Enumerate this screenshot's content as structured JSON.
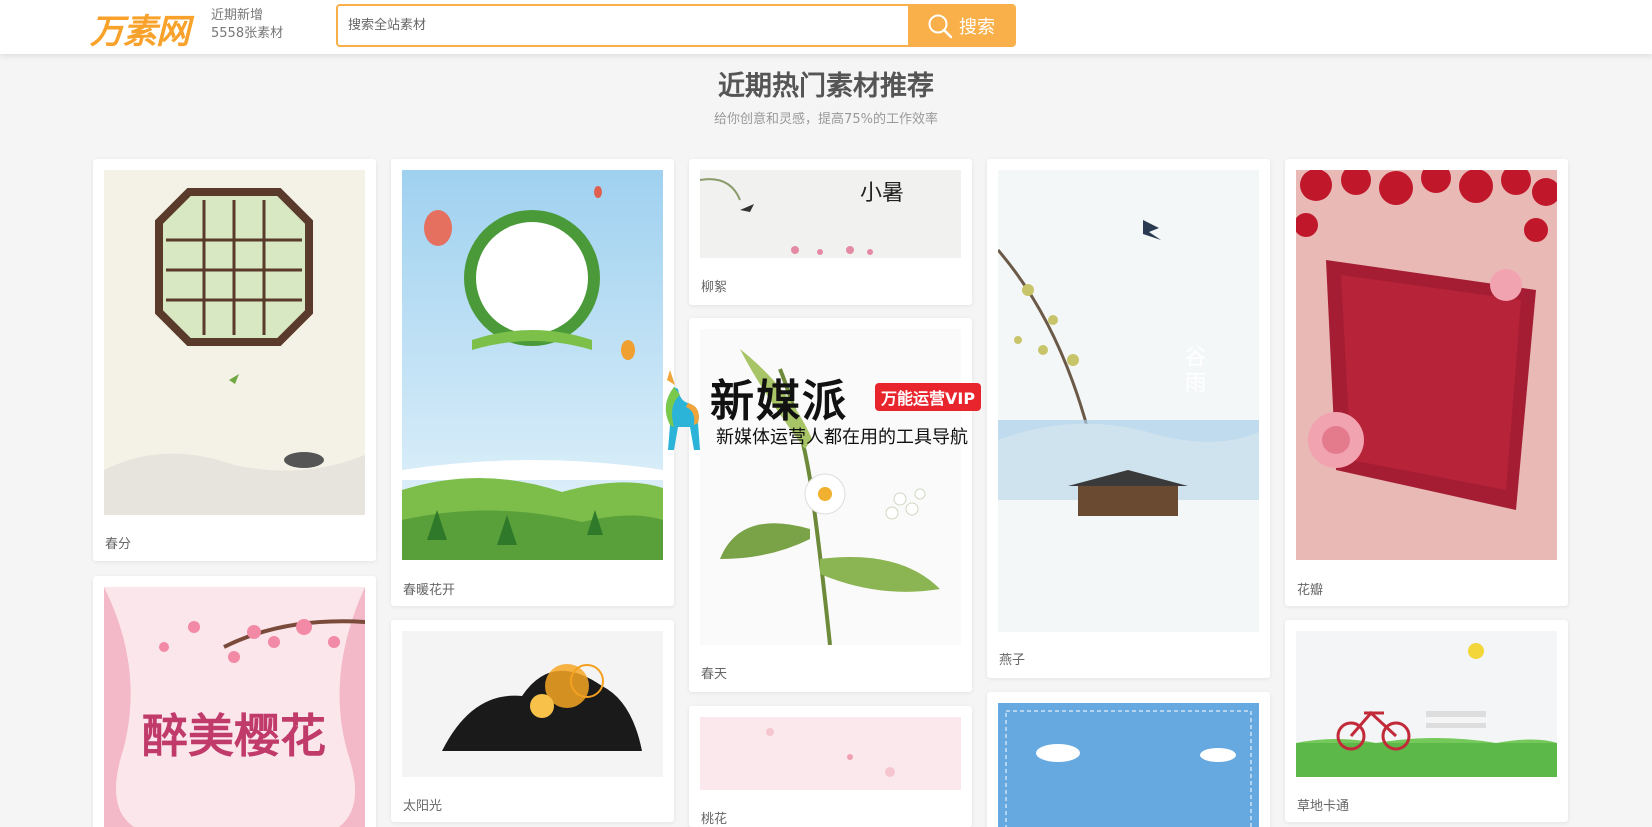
{
  "header": {
    "logo": "万素网",
    "logo_sub_line1": "近期新增",
    "logo_sub_line2": "5558张素材",
    "search_placeholder": "搜索全站素材",
    "search_button": "搜索"
  },
  "section": {
    "title": "近期热门素材推荐",
    "subtitle": "给你创意和灵感，提高75%的工作效率"
  },
  "cards": {
    "c1": "春分",
    "c2": "春暖花开",
    "c3": "柳絮",
    "c4": "春天",
    "c5": "燕子",
    "c6": "花瓣",
    "c7": "太阳光",
    "c8": "桃花",
    "c9": "草地卡通"
  },
  "thumb_text": {
    "c3": "小暑",
    "c5": "谷雨",
    "c10": "醉美樱花"
  },
  "watermark": {
    "title": "新媒派",
    "badge": "万能运营VIP",
    "subtitle": "新媒体运营人都在用的工具导航"
  }
}
